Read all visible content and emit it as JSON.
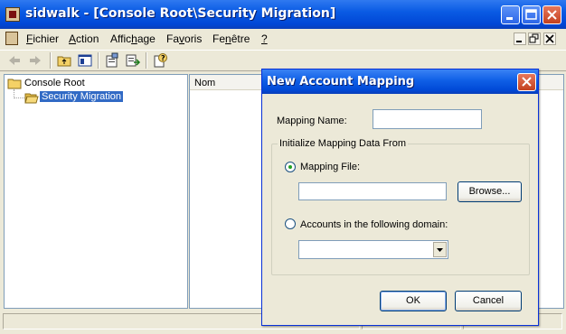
{
  "window": {
    "title": "sidwalk - [Console Root\\Security Migration]",
    "controls": [
      "minimize",
      "maximize",
      "close"
    ]
  },
  "menu": {
    "items": [
      {
        "label": "Fichier",
        "accel": "F"
      },
      {
        "label": "Action",
        "accel": "A"
      },
      {
        "label": "Affichage",
        "accel": "h"
      },
      {
        "label": "Favoris",
        "accel": "v"
      },
      {
        "label": "Fenêtre",
        "accel": "n"
      },
      {
        "label": "?",
        "accel": "?"
      }
    ]
  },
  "toolbar": {
    "icons": [
      "back-arrow-icon",
      "forward-arrow-icon",
      "up-folder-icon",
      "show-hide-tree-icon",
      "properties-icon",
      "export-list-icon",
      "help-icon"
    ]
  },
  "tree": {
    "root": "Console Root",
    "child": "Security Migration"
  },
  "list": {
    "columns": [
      "Nom"
    ]
  },
  "dialog": {
    "title": "New Account Mapping",
    "mapping_name_label": "Mapping Name:",
    "mapping_name_value": "",
    "group_title": "Initialize Mapping Data From",
    "radio_file_label": "Mapping File:",
    "radio_file_selected": true,
    "file_value": "",
    "browse_label": "Browse...",
    "radio_domain_label": "Accounts in the following domain:",
    "radio_domain_selected": false,
    "domain_value": "",
    "ok_label": "OK",
    "cancel_label": "Cancel"
  },
  "colors": {
    "titlebar": "#0a5be4",
    "selection": "#316ac5",
    "face": "#ece9d8"
  }
}
